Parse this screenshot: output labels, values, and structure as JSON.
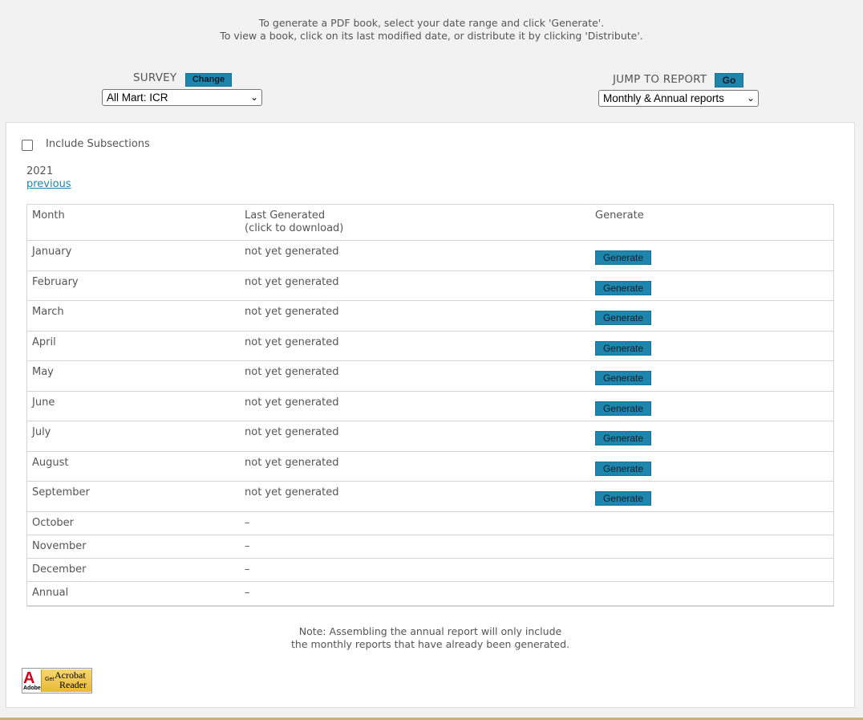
{
  "intro": {
    "line1": "To generate a PDF book, select your date range and click 'Generate'.",
    "line2": "To view a book, click on its last modified date, or distribute it by clicking 'Distribute'."
  },
  "survey": {
    "label": "SURVEY",
    "change_button": "Change",
    "selected": "All Mart: ICR"
  },
  "jump": {
    "label": "JUMP TO REPORT",
    "go_button": "Go",
    "selected": "Monthly & Annual reports"
  },
  "options": {
    "include_subsections_label": "Include Subsections",
    "include_subsections_checked": false
  },
  "year": "2021",
  "previous_link": "previous",
  "table": {
    "headers": {
      "month": "Month",
      "last_generated_line1": "Last Generated",
      "last_generated_line2": "(click to download)",
      "generate": "Generate"
    },
    "rows": [
      {
        "month": "January",
        "status": "not yet generated",
        "button": "Generate"
      },
      {
        "month": "February",
        "status": "not yet generated",
        "button": "Generate"
      },
      {
        "month": "March",
        "status": "not yet generated",
        "button": "Generate"
      },
      {
        "month": "April",
        "status": "not yet generated",
        "button": "Generate"
      },
      {
        "month": "May",
        "status": "not yet generated",
        "button": "Generate"
      },
      {
        "month": "June",
        "status": "not yet generated",
        "button": "Generate"
      },
      {
        "month": "July",
        "status": "not yet generated",
        "button": "Generate"
      },
      {
        "month": "August",
        "status": "not yet generated",
        "button": "Generate"
      },
      {
        "month": "September",
        "status": "not yet generated",
        "button": "Generate"
      },
      {
        "month": "October",
        "status": "–"
      },
      {
        "month": "November",
        "status": "–"
      },
      {
        "month": "December",
        "status": "–"
      },
      {
        "month": "Annual",
        "status": "–"
      }
    ]
  },
  "note": {
    "line1": "Note: Assembling the annual report will only include",
    "line2": "the monthly reports that have already been generated."
  },
  "badge": {
    "logo_letter": "A",
    "brand": "Adobe",
    "get": "Get",
    "product1": "Acrobat",
    "product2": "Reader"
  },
  "colors": {
    "accent": "#1e86ad",
    "background": "#f2f2f2"
  }
}
